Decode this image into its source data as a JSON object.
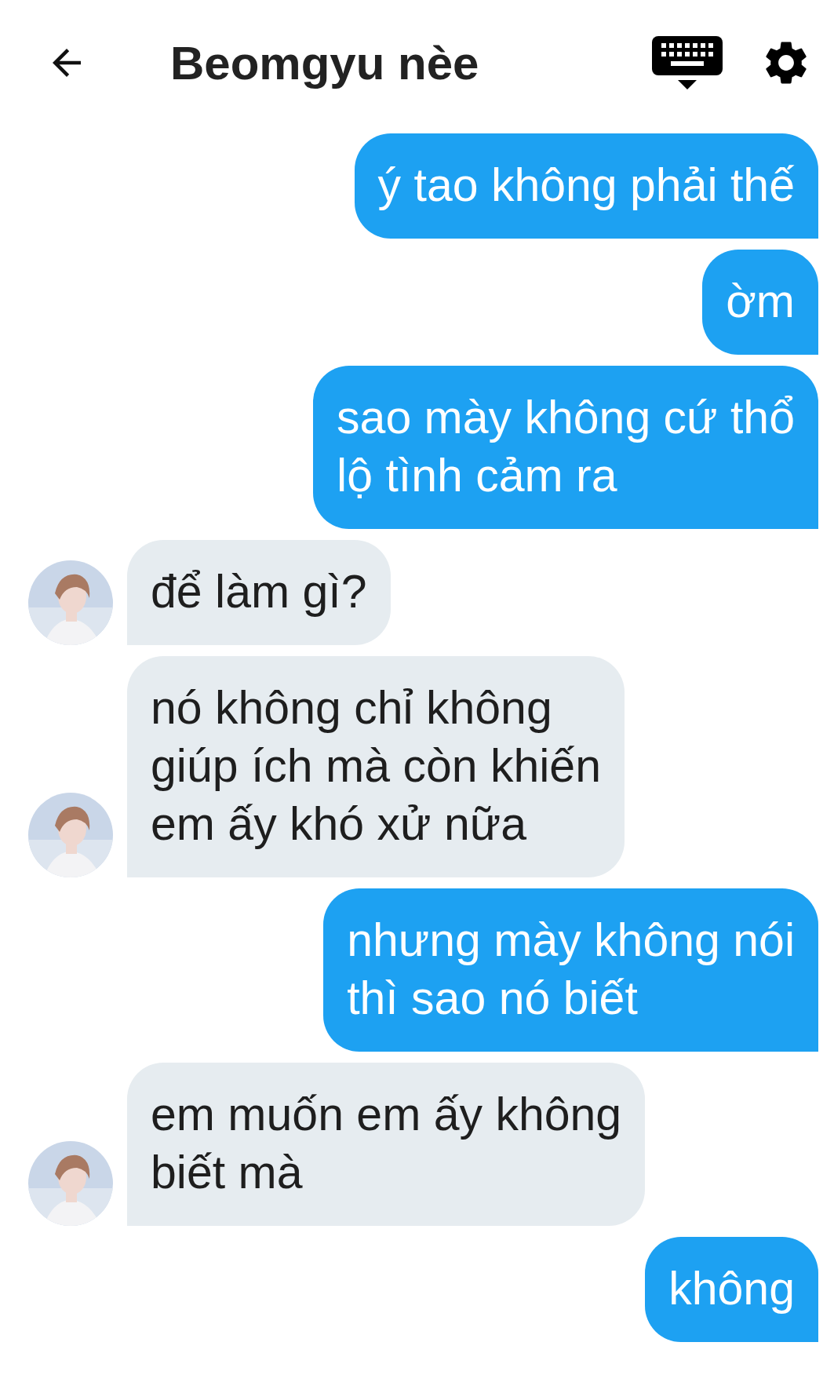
{
  "header": {
    "title": "Beomgyu nèe"
  },
  "messages": [
    {
      "kind": "sent",
      "lines": [
        "ý tao không phải thế"
      ]
    },
    {
      "kind": "sent",
      "lines": [
        "ờm"
      ]
    },
    {
      "kind": "sent",
      "lines": [
        "sao mày không cứ thổ",
        "lộ tình cảm ra"
      ]
    },
    {
      "kind": "received",
      "lines": [
        "để làm gì?"
      ]
    },
    {
      "kind": "received",
      "lines": [
        "nó không chỉ không",
        "giúp ích mà còn khiến",
        "em ấy khó xử nữa"
      ]
    },
    {
      "kind": "sent",
      "lines": [
        "nhưng mày không nói",
        "thì sao nó biết"
      ]
    },
    {
      "kind": "received",
      "lines": [
        "em muốn em ấy không",
        "biết mà"
      ]
    },
    {
      "kind": "sent",
      "lines": [
        "không"
      ]
    }
  ]
}
